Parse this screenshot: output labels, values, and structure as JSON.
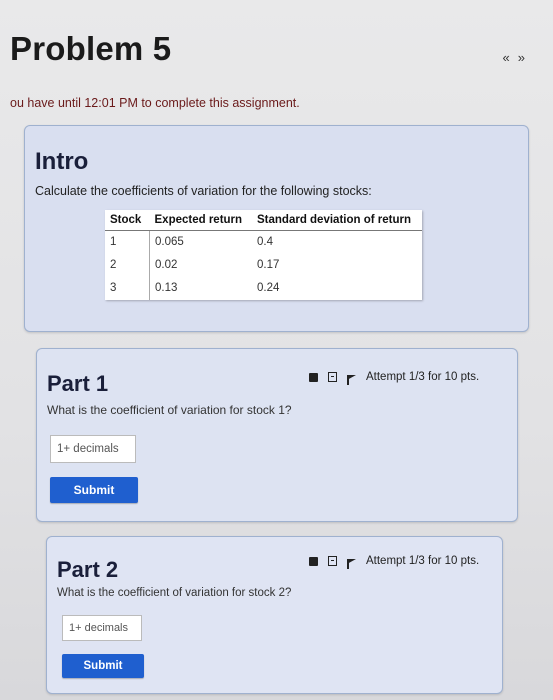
{
  "header": {
    "title": "Problem 5",
    "prev_icon": "double-chevron-left-icon",
    "next_icon": "double-chevron-right-icon",
    "prev_glyph": "«",
    "next_glyph": "»",
    "due_text": "ou have until 12:01 PM to complete this assignment."
  },
  "intro": {
    "heading": "Intro",
    "text": "Calculate the coefficients of variation for the following stocks:",
    "table": {
      "headers": [
        "Stock",
        "Expected return",
        "Standard deviation of return"
      ],
      "rows": [
        [
          "1",
          "0.065",
          "0.4"
        ],
        [
          "2",
          "0.02",
          "0.17"
        ],
        [
          "3",
          "0.13",
          "0.24"
        ]
      ]
    }
  },
  "parts": [
    {
      "heading": "Part 1",
      "question": "What is the coefficient of variation for stock 1?",
      "attempt": "Attempt 1/3 for 10 pts.",
      "placeholder": "1+ decimals",
      "submit": "Submit"
    },
    {
      "heading": "Part 2",
      "question": "What is the coefficient of variation for stock 2?",
      "attempt": "Attempt 1/3 for 10 pts.",
      "placeholder": "1+ decimals",
      "submit": "Submit"
    }
  ],
  "colors": {
    "submit_bg": "#1f5fcf",
    "panel_bg": "#dbe1f0",
    "panel_border": "#9fb1cf"
  }
}
